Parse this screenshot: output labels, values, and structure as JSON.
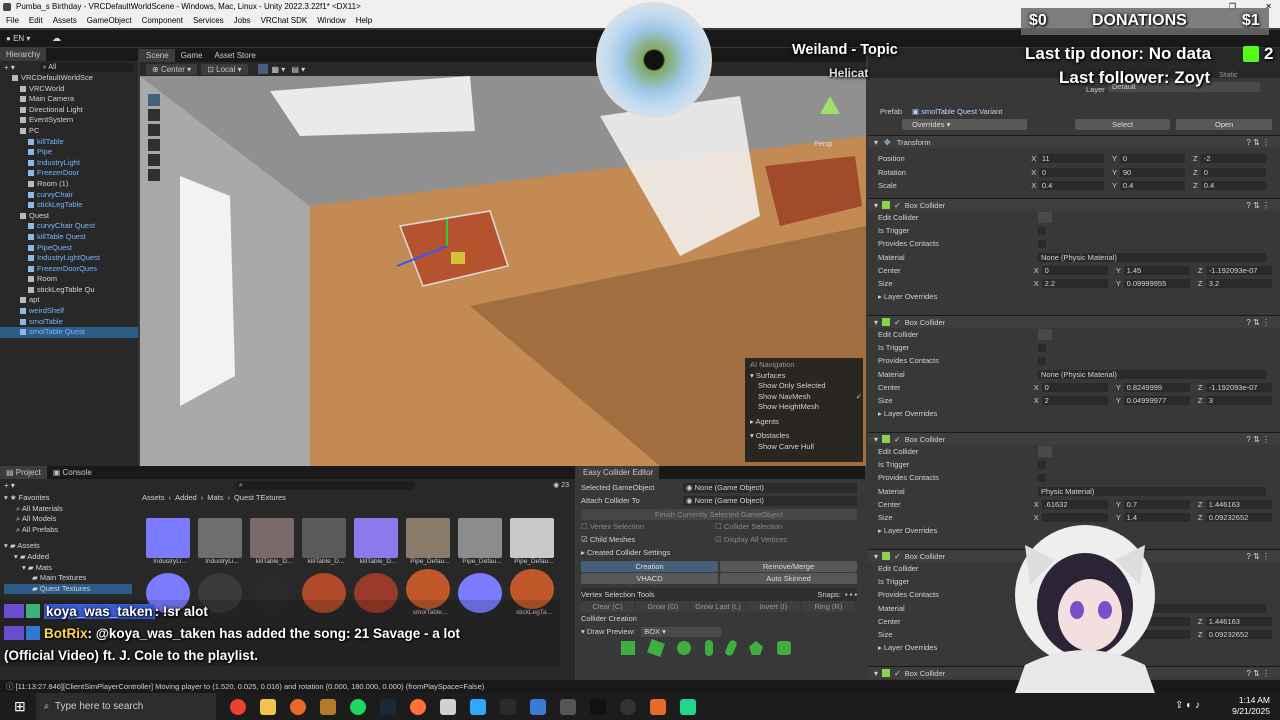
{
  "window": {
    "title": "Pumba_s Birthday - VRCDefaultWorldScene - Windows, Mac, Linux - Unity 2022.3.22f1* <DX11>"
  },
  "menu": [
    "File",
    "Edit",
    "Assets",
    "GameObject",
    "Component",
    "Services",
    "Jobs",
    "VRChat SDK",
    "Window",
    "Help"
  ],
  "unity_toolbar": {
    "account": "EN"
  },
  "hierarchy": {
    "tab": "Hierarchy",
    "search_placeholder": "All",
    "items": [
      {
        "label": "VRCDefaultWorldSce",
        "indent": 1,
        "blue": false
      },
      {
        "label": "VRCWorld",
        "indent": 2,
        "blue": false
      },
      {
        "label": "Main Camera",
        "indent": 2,
        "blue": false
      },
      {
        "label": "Directional Light",
        "indent": 2,
        "blue": false
      },
      {
        "label": "EventSystem",
        "indent": 2,
        "blue": false
      },
      {
        "label": "PC",
        "indent": 2,
        "blue": false
      },
      {
        "label": "killTable",
        "indent": 3,
        "blue": true
      },
      {
        "label": "Pipe",
        "indent": 3,
        "blue": true
      },
      {
        "label": "IndustryLight",
        "indent": 3,
        "blue": true
      },
      {
        "label": "FreezerDoor",
        "indent": 3,
        "blue": true
      },
      {
        "label": "Room (1)",
        "indent": 3,
        "blue": false
      },
      {
        "label": "curvyChair",
        "indent": 3,
        "blue": true
      },
      {
        "label": "stickLegTable",
        "indent": 3,
        "blue": true
      },
      {
        "label": "Quest",
        "indent": 2,
        "blue": false
      },
      {
        "label": "curvyChair Quest",
        "indent": 3,
        "blue": true
      },
      {
        "label": "killTable Quest",
        "indent": 3,
        "blue": true
      },
      {
        "label": "PipeQuest",
        "indent": 3,
        "blue": true
      },
      {
        "label": "IndustryLightQuest",
        "indent": 3,
        "blue": true
      },
      {
        "label": "FreezerDoorQues",
        "indent": 3,
        "blue": true
      },
      {
        "label": "Room",
        "indent": 3,
        "blue": false
      },
      {
        "label": "stickLegTable Qu",
        "indent": 3,
        "blue": false
      },
      {
        "label": "apt",
        "indent": 2,
        "blue": false
      },
      {
        "label": "weirdShelf",
        "indent": 2,
        "blue": true
      },
      {
        "label": "smolTable",
        "indent": 2,
        "blue": true
      },
      {
        "label": "smolTable Quest",
        "indent": 2,
        "blue": true,
        "selected": true
      }
    ]
  },
  "scene": {
    "tabs": [
      "Scene",
      "Game",
      "Asset Store"
    ],
    "tools": [
      "Center",
      "Local"
    ],
    "gizmo_label": "Persp",
    "ai_nav": {
      "title": "AI Navigation",
      "surfaces": "Surfaces",
      "options": [
        "Show Only Selected",
        "Show NavMesh",
        "Show HeightMesh"
      ],
      "agents": "Agents",
      "obstacles": "Obstacles",
      "carve": "Show Carve Hull"
    }
  },
  "overlay": {
    "song_title": "Weiland - Topic",
    "song_artist": "Helicat",
    "donations_label": "DONATIONS",
    "donations_left": "$0",
    "donations_right": "$1",
    "tip_donor": "Last tip donor: No data",
    "follower": "Last follower: Zoyt",
    "kick_count": "2"
  },
  "inspector": {
    "layer_label": "Layer",
    "layer_value": "Default",
    "static_label": "Static",
    "prefab_label": "Prefab",
    "prefab_value": "smolTable Quest Variant",
    "overrides": "Overrides",
    "select": "Select",
    "open": "Open",
    "transform": {
      "title": "Transform",
      "position": {
        "label": "Position",
        "x": "11",
        "y": "0",
        "z": "-2"
      },
      "rotation": {
        "label": "Rotation",
        "x": "0",
        "y": "90",
        "z": "0"
      },
      "scale": {
        "label": "Scale",
        "x": "0.4",
        "y": "0.4",
        "z": "0.4"
      }
    },
    "colliders": [
      {
        "title": "Box Collider",
        "edit": "Edit Collider",
        "trigger": "Is Trigger",
        "contacts": "Provides Contacts",
        "material_label": "Material",
        "material": "None (Physic Material)",
        "center_label": "Center",
        "center": {
          "x": "0",
          "y": "1.45",
          "z": "-1.192093e-07"
        },
        "size_label": "Size",
        "size": {
          "x": "2.2",
          "y": "0.09999955",
          "z": "3.2"
        },
        "layer_overrides": "Layer Overrides"
      },
      {
        "title": "Box Collider",
        "edit": "Edit Collider",
        "trigger": "Is Trigger",
        "contacts": "Provides Contacts",
        "material_label": "Material",
        "material": "None (Physic Material)",
        "center_label": "Center",
        "center": {
          "x": "0",
          "y": "0.8249999",
          "z": "-1.192093e-07"
        },
        "size_label": "Size",
        "size": {
          "x": "2",
          "y": "0.04999977",
          "z": "3"
        },
        "layer_overrides": "Layer Overrides"
      },
      {
        "title": "Box Collider",
        "edit": "Edit Collider",
        "trigger": "Is Trigger",
        "contacts": "Provides Contacts",
        "material_label": "Material",
        "material": "Physic Material)",
        "center_label": "Center",
        "center": {
          "x": ".61632",
          "y": "0.7",
          "z": "1.446163"
        },
        "size_label": "Size",
        "size": {
          "x": "",
          "y": "1.4",
          "z": "0.09232652"
        },
        "layer_overrides": "Layer Overrides"
      },
      {
        "title": "Box Collider",
        "edit": "Edit Collider",
        "trigger": "Is Trigger",
        "contacts": "Provides Contacts",
        "material_label": "Material",
        "material": "",
        "center_label": "Center",
        "center": {
          "x": "",
          "y": "",
          "z": "1.446163"
        },
        "size_label": "Size",
        "size": {
          "x": "",
          "y": "",
          "z": "0.09232652"
        },
        "layer_overrides": "Layer Overrides"
      },
      {
        "title": "Box Collider"
      }
    ]
  },
  "project": {
    "tabs": [
      "Project",
      "Console"
    ],
    "favorites": "Favorites",
    "fav_items": [
      "All Materials",
      "All Models",
      "All Prefabs"
    ],
    "assets": "Assets",
    "tree": [
      "Added",
      "Mats",
      "Main Textures",
      "Quest Textures"
    ],
    "breadcrumb": [
      "Assets",
      "Added",
      "Mats",
      "Quest TExtures"
    ],
    "count": "23",
    "row1": [
      "IndustryLi...",
      "IndustryLi...",
      "killTable_D...",
      "killTable_D...",
      "killTable_D...",
      "Pipe_Defau...",
      "Pipe_Defau...",
      "Pipe_Defau..."
    ],
    "row2": [
      "",
      "",
      "",
      "",
      "",
      "smolTable...",
      "",
      "stickLegTa..."
    ],
    "row1_colors": [
      "#7b7bff",
      "#6e6e6e",
      "#7a6a6a",
      "#5a5a5a",
      "#8a7aee",
      "#8a7a6a",
      "#8c8c8c",
      "#c8c8c8"
    ],
    "row2_colors": [
      "#7b7bff",
      "#3a3a3a",
      "#2a2a2a",
      "#b04a2a",
      "#9a3a2a",
      "#c0582a",
      "#7b7bff",
      "#c0582a"
    ]
  },
  "easy_collider": {
    "title": "Easy Collider Editor",
    "selected_label": "Selected GameObject",
    "selected_value": "None (Game Object)",
    "attach_label": "Attach Collider To",
    "attach_value": "None (Game Object)",
    "finish": "Finish Currently Selected GameObject",
    "vertex_sel": "Vertex Selection",
    "collider_sel": "Collider Selection",
    "child_meshes": "Child Meshes",
    "display_vertices": "Display All Vertices",
    "created_settings": "Created Collider Settings",
    "creation": "Creation",
    "remove_merge": "Remove/Merge",
    "vhacd": "VHACD",
    "auto_skinned": "Auto Skinned",
    "vertex_tools": "Vertex Selection Tools",
    "snaps": "Snaps:",
    "tool_buttons": [
      "Clear (C)",
      "Grow (G)",
      "Grow Last (L)",
      "Invert (I)",
      "Ring (R)"
    ],
    "collider_creation": "Collider Creation",
    "draw_preview": "Draw Preview:",
    "draw_value": "BOX"
  },
  "chat": [
    {
      "user": "koya_was_taken",
      "msg": ": !sr alot"
    },
    {
      "user": "BotRix",
      "msg": ": @koya_was_taken has added the song: 21 Savage - a lot"
    },
    {
      "user": "",
      "msg": "(Official Video) ft. J. Cole to the playlist."
    }
  ],
  "status": {
    "text": "[11:13:27.846][ClientSimPlayerController] Moving player to (1.520, 0.025, 0.016) and rotation (0.000, 180.000, 0.000) (fromPlaySpace=False)"
  },
  "taskbar": {
    "search": "Type here to search",
    "time": "1:14 AM",
    "date": "9/21/2025"
  },
  "colors": {
    "selection": "#2c5d87",
    "accent": "#3a72b0",
    "bg": "#383838"
  }
}
